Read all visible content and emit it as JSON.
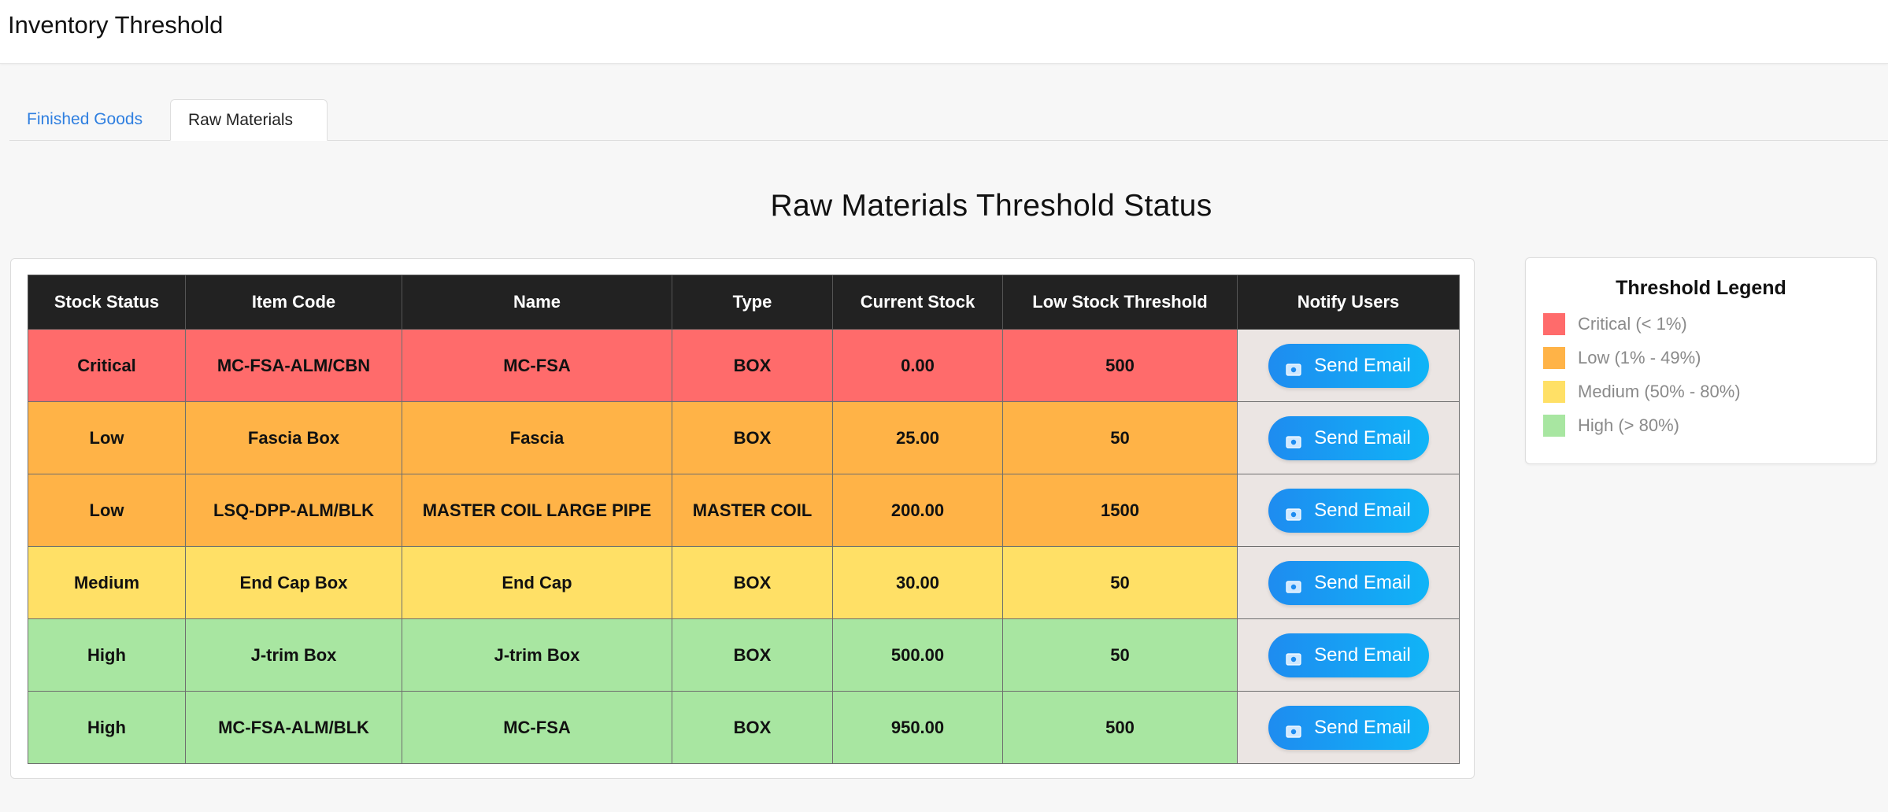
{
  "app": {
    "title": "Inventory Threshold"
  },
  "tabs": [
    {
      "label": "Finished Goods",
      "active": false
    },
    {
      "label": "Raw Materials",
      "active": true
    }
  ],
  "section": {
    "title": "Raw Materials Threshold Status"
  },
  "table": {
    "headers": [
      "Stock Status",
      "Item Code",
      "Name",
      "Type",
      "Current Stock",
      "Low Stock Threshold",
      "Notify Users"
    ],
    "rows": [
      {
        "status": "Critical",
        "item_code": "MC-FSA-ALM/CBN",
        "name": "MC-FSA",
        "type": "BOX",
        "current_stock": "0.00",
        "threshold": "500",
        "action": "Send Email"
      },
      {
        "status": "Low",
        "item_code": "Fascia Box",
        "name": "Fascia",
        "type": "BOX",
        "current_stock": "25.00",
        "threshold": "50",
        "action": "Send Email"
      },
      {
        "status": "Low",
        "item_code": "LSQ-DPP-ALM/BLK",
        "name": "MASTER COIL LARGE PIPE",
        "type": "MASTER COIL",
        "current_stock": "200.00",
        "threshold": "1500",
        "action": "Send Email"
      },
      {
        "status": "Medium",
        "item_code": "End Cap Box",
        "name": "End Cap",
        "type": "BOX",
        "current_stock": "30.00",
        "threshold": "50",
        "action": "Send Email"
      },
      {
        "status": "High",
        "item_code": "J-trim Box",
        "name": "J-trim Box",
        "type": "BOX",
        "current_stock": "500.00",
        "threshold": "50",
        "action": "Send Email"
      },
      {
        "status": "High",
        "item_code": "MC-FSA-ALM/BLK",
        "name": "MC-FSA",
        "type": "BOX",
        "current_stock": "950.00",
        "threshold": "500",
        "action": "Send Email"
      }
    ]
  },
  "legend": {
    "title": "Threshold Legend",
    "items": [
      {
        "label": "Critical (< 1%)",
        "color": "#ff6b6b"
      },
      {
        "label": "Low (1% - 49%)",
        "color": "#ffb347"
      },
      {
        "label": "Medium (50% - 80%)",
        "color": "#ffe066"
      },
      {
        "label": "High (> 80%)",
        "color": "#a8e6a1"
      }
    ]
  },
  "icons": {
    "send_email": "email-icon"
  },
  "colors": {
    "critical": "#ff6b6b",
    "low": "#ffb347",
    "medium": "#ffe066",
    "high": "#a8e6a1",
    "header": "#222222",
    "accent": "#1e8cf0",
    "tab_link": "#2f7fe0"
  }
}
